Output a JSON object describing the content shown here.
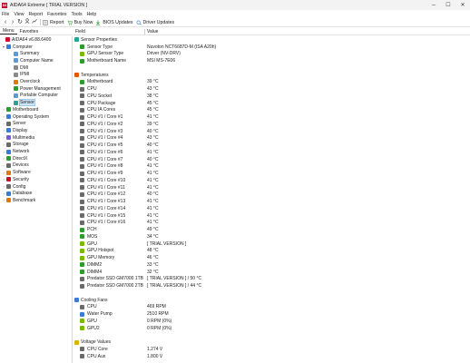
{
  "window": {
    "title": "AIDA64 Extreme  [ TRIAL VERSION ]",
    "app_icon_text": "64",
    "min": "─",
    "max": "☐",
    "close": "✕"
  },
  "menubar": [
    "File",
    "View",
    "Report",
    "Favorites",
    "Tools",
    "Help"
  ],
  "toolbar": {
    "back": "‹",
    "forward": "›",
    "refresh": "↻",
    "user": "👤",
    "chart": "📈",
    "report": "Report",
    "buy_now": "Buy Now",
    "bios_updates": "BIOS Updates",
    "driver_updates": "Driver Updates"
  },
  "panel_tabs": [
    "Menu",
    "Favorites"
  ],
  "tree": [
    {
      "label": "AIDA64 v6.88.6400",
      "level": 0,
      "expander": "",
      "icon": "aida64-icon",
      "color": "#c8102e"
    },
    {
      "label": "Computer",
      "level": 1,
      "expander": "▾",
      "icon": "computer-icon",
      "color": "#3a7bd5"
    },
    {
      "label": "Summary",
      "level": 2,
      "expander": "",
      "icon": "summary-icon",
      "color": "#5b9bd5"
    },
    {
      "label": "Computer Name",
      "level": 2,
      "expander": "",
      "icon": "computer-name-icon",
      "color": "#5b9bd5"
    },
    {
      "label": "DMI",
      "level": 2,
      "expander": "",
      "icon": "dmi-icon",
      "color": "#8a8a8a"
    },
    {
      "label": "IPMI",
      "level": 2,
      "expander": "",
      "icon": "ipmi-icon",
      "color": "#8a8a8a"
    },
    {
      "label": "Overclock",
      "level": 2,
      "expander": "",
      "icon": "overclock-icon",
      "color": "#e07b00"
    },
    {
      "label": "Power Management",
      "level": 2,
      "expander": "",
      "icon": "power-icon",
      "color": "#2e9b2e"
    },
    {
      "label": "Portable Computer",
      "level": 2,
      "expander": "",
      "icon": "portable-icon",
      "color": "#5b9bd5"
    },
    {
      "label": "Sensor",
      "level": 2,
      "expander": "",
      "icon": "sensor-icon",
      "color": "#2aa198",
      "selected": true
    },
    {
      "label": "Motherboard",
      "level": 1,
      "expander": "›",
      "icon": "motherboard-icon",
      "color": "#2e9b2e"
    },
    {
      "label": "Operating System",
      "level": 1,
      "expander": "›",
      "icon": "os-icon",
      "color": "#3a7bd5"
    },
    {
      "label": "Server",
      "level": 1,
      "expander": "›",
      "icon": "server-icon",
      "color": "#6a6a6a"
    },
    {
      "label": "Display",
      "level": 1,
      "expander": "›",
      "icon": "display-icon",
      "color": "#3a7bd5"
    },
    {
      "label": "Multimedia",
      "level": 1,
      "expander": "›",
      "icon": "multimedia-icon",
      "color": "#7a5bd5"
    },
    {
      "label": "Storage",
      "level": 1,
      "expander": "›",
      "icon": "storage-icon",
      "color": "#6a6a6a"
    },
    {
      "label": "Network",
      "level": 1,
      "expander": "›",
      "icon": "network-icon",
      "color": "#3a7bd5"
    },
    {
      "label": "DirectX",
      "level": 1,
      "expander": "›",
      "icon": "directx-icon",
      "color": "#2e9b2e"
    },
    {
      "label": "Devices",
      "level": 1,
      "expander": "›",
      "icon": "devices-icon",
      "color": "#6a6a6a"
    },
    {
      "label": "Software",
      "level": 1,
      "expander": "›",
      "icon": "software-icon",
      "color": "#e07b00"
    },
    {
      "label": "Security",
      "level": 1,
      "expander": "›",
      "icon": "security-icon",
      "color": "#c8102e"
    },
    {
      "label": "Config",
      "level": 1,
      "expander": "›",
      "icon": "config-icon",
      "color": "#6a6a6a"
    },
    {
      "label": "Database",
      "level": 1,
      "expander": "›",
      "icon": "database-icon",
      "color": "#3a7bd5"
    },
    {
      "label": "Benchmark",
      "level": 1,
      "expander": "›",
      "icon": "benchmark-icon",
      "color": "#e07b00"
    }
  ],
  "columns": {
    "field": "Field",
    "value": "Value"
  },
  "rows": [
    {
      "type": "section",
      "field": "Sensor Properties",
      "icon": "sensor-properties-icon",
      "color": "#2aa198"
    },
    {
      "type": "item",
      "field": "Sensor Type",
      "value": "Nuvoton NCT6687D-M  (ISA A20h)",
      "icon": "chip-icon",
      "color": "#2e9b2e"
    },
    {
      "type": "item",
      "field": "GPU Sensor Type",
      "value": "Driver  (NV-DRV)",
      "icon": "gpu-icon",
      "color": "#76b900"
    },
    {
      "type": "item",
      "field": "Motherboard Name",
      "value": "MSI MS-7E06",
      "icon": "motherboard-icon",
      "color": "#2e9b2e"
    },
    {
      "type": "blank"
    },
    {
      "type": "section",
      "field": "Temperatures",
      "icon": "temperature-icon",
      "color": "#e05a00"
    },
    {
      "type": "item",
      "field": "Motherboard",
      "value": "39 °C",
      "icon": "motherboard-icon",
      "color": "#2e9b2e"
    },
    {
      "type": "item",
      "field": "CPU",
      "value": "43 °C",
      "icon": "cpu-icon",
      "color": "#6a6a6a"
    },
    {
      "type": "item",
      "field": "CPU Socket",
      "value": "38 °C",
      "icon": "cpu-icon",
      "color": "#6a6a6a"
    },
    {
      "type": "item",
      "field": "CPU Package",
      "value": "45 °C",
      "icon": "cpu-icon",
      "color": "#6a6a6a"
    },
    {
      "type": "item",
      "field": "CPU IA Cores",
      "value": "45 °C",
      "icon": "cpu-icon",
      "color": "#6a6a6a"
    },
    {
      "type": "item",
      "field": "CPU #1 / Core #1",
      "value": "41 °C",
      "icon": "cpu-icon",
      "color": "#6a6a6a"
    },
    {
      "type": "item",
      "field": "CPU #1 / Core #2",
      "value": "39 °C",
      "icon": "cpu-icon",
      "color": "#6a6a6a"
    },
    {
      "type": "item",
      "field": "CPU #1 / Core #3",
      "value": "40 °C",
      "icon": "cpu-icon",
      "color": "#6a6a6a"
    },
    {
      "type": "item",
      "field": "CPU #1 / Core #4",
      "value": "43 °C",
      "icon": "cpu-icon",
      "color": "#6a6a6a"
    },
    {
      "type": "item",
      "field": "CPU #1 / Core #5",
      "value": "40 °C",
      "icon": "cpu-icon",
      "color": "#6a6a6a"
    },
    {
      "type": "item",
      "field": "CPU #1 / Core #6",
      "value": "41 °C",
      "icon": "cpu-icon",
      "color": "#6a6a6a"
    },
    {
      "type": "item",
      "field": "CPU #1 / Core #7",
      "value": "40 °C",
      "icon": "cpu-icon",
      "color": "#6a6a6a"
    },
    {
      "type": "item",
      "field": "CPU #1 / Core #8",
      "value": "41 °C",
      "icon": "cpu-icon",
      "color": "#6a6a6a"
    },
    {
      "type": "item",
      "field": "CPU #1 / Core #9",
      "value": "41 °C",
      "icon": "cpu-icon",
      "color": "#6a6a6a"
    },
    {
      "type": "item",
      "field": "CPU #1 / Core #10",
      "value": "41 °C",
      "icon": "cpu-icon",
      "color": "#6a6a6a"
    },
    {
      "type": "item",
      "field": "CPU #1 / Core #11",
      "value": "41 °C",
      "icon": "cpu-icon",
      "color": "#6a6a6a"
    },
    {
      "type": "item",
      "field": "CPU #1 / Core #12",
      "value": "40 °C",
      "icon": "cpu-icon",
      "color": "#6a6a6a"
    },
    {
      "type": "item",
      "field": "CPU #1 / Core #13",
      "value": "41 °C",
      "icon": "cpu-icon",
      "color": "#6a6a6a"
    },
    {
      "type": "item",
      "field": "CPU #1 / Core #14",
      "value": "41 °C",
      "icon": "cpu-icon",
      "color": "#6a6a6a"
    },
    {
      "type": "item",
      "field": "CPU #1 / Core #15",
      "value": "41 °C",
      "icon": "cpu-icon",
      "color": "#6a6a6a"
    },
    {
      "type": "item",
      "field": "CPU #1 / Core #16",
      "value": "41 °C",
      "icon": "cpu-icon",
      "color": "#6a6a6a"
    },
    {
      "type": "item",
      "field": "PCH",
      "value": "49 °C",
      "icon": "pch-icon",
      "color": "#2e9b2e"
    },
    {
      "type": "item",
      "field": "MOS",
      "value": "34 °C",
      "icon": "mos-icon",
      "color": "#2e9b2e"
    },
    {
      "type": "item",
      "field": "GPU",
      "value": "[ TRIAL VERSION ]",
      "icon": "gpu-icon",
      "color": "#76b900"
    },
    {
      "type": "item",
      "field": "GPU Hotspot",
      "value": "48 °C",
      "icon": "gpu-icon",
      "color": "#76b900"
    },
    {
      "type": "item",
      "field": "GPU Memory",
      "value": "46 °C",
      "icon": "gpu-icon",
      "color": "#76b900"
    },
    {
      "type": "item",
      "field": "DIMM2",
      "value": "33 °C",
      "icon": "dimm-icon",
      "color": "#2e9b2e"
    },
    {
      "type": "item",
      "field": "DIMM4",
      "value": "32 °C",
      "icon": "dimm-icon",
      "color": "#2e9b2e"
    },
    {
      "type": "item",
      "field": "Predator SSD GM7000 1TB",
      "value": "[ TRIAL VERSION ] / 50 °C",
      "icon": "ssd-icon",
      "color": "#6a6a6a"
    },
    {
      "type": "item",
      "field": "Predator SSD GM7000 2TB",
      "value": "[ TRIAL VERSION ] / 44 °C",
      "icon": "ssd-icon",
      "color": "#6a6a6a"
    },
    {
      "type": "blank"
    },
    {
      "type": "section",
      "field": "Cooling Fans",
      "icon": "fan-icon",
      "color": "#3a7bd5"
    },
    {
      "type": "item",
      "field": "CPU",
      "value": "469 RPM",
      "icon": "cpu-icon",
      "color": "#6a6a6a"
    },
    {
      "type": "item",
      "field": "Water Pump",
      "value": "2510 RPM",
      "icon": "pump-icon",
      "color": "#3a7bd5"
    },
    {
      "type": "item",
      "field": "GPU",
      "value": "0 RPM  (0%)",
      "icon": "gpu-icon",
      "color": "#76b900"
    },
    {
      "type": "item",
      "field": "GPU2",
      "value": "0 RPM  (0%)",
      "icon": "gpu-icon",
      "color": "#76b900"
    },
    {
      "type": "blank"
    },
    {
      "type": "section",
      "field": "Voltage Values",
      "icon": "voltage-icon",
      "color": "#e0b000"
    },
    {
      "type": "item",
      "field": "CPU Core",
      "value": "1.274 V",
      "icon": "cpu-icon",
      "color": "#6a6a6a"
    },
    {
      "type": "item",
      "field": "CPU Aux",
      "value": "1.800 V",
      "icon": "cpu-icon",
      "color": "#6a6a6a"
    }
  ]
}
